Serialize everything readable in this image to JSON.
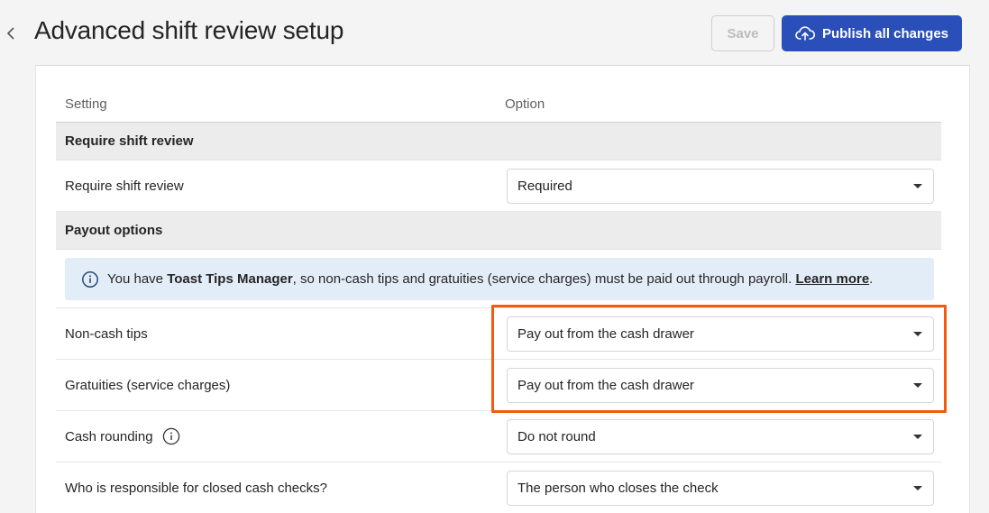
{
  "header": {
    "title": "Advanced shift review setup",
    "save_label": "Save",
    "publish_label": "Publish all changes"
  },
  "table": {
    "col_setting": "Setting",
    "col_option": "Option"
  },
  "sections": {
    "shift_review": {
      "title": "Require shift review",
      "row_label": "Require shift review",
      "row_value": "Required"
    },
    "payout": {
      "title": "Payout options",
      "banner_pre": "You have ",
      "banner_bold": "Toast Tips Manager",
      "banner_post": ", so non-cash tips and gratuities (service charges) must be paid out through payroll. ",
      "banner_link": "Learn more",
      "banner_end": ".",
      "rows": [
        {
          "label": "Non-cash tips",
          "value": "Pay out from the cash drawer"
        },
        {
          "label": "Gratuities (service charges)",
          "value": "Pay out from the cash drawer"
        },
        {
          "label": "Cash rounding",
          "value": "Do not round"
        },
        {
          "label": "Who is responsible for closed cash checks?",
          "value": "The person who closes the check"
        }
      ]
    }
  },
  "colors": {
    "primary": "#2b4fb9",
    "highlight": "#f25a0f",
    "info_bg": "#e3edf8"
  }
}
